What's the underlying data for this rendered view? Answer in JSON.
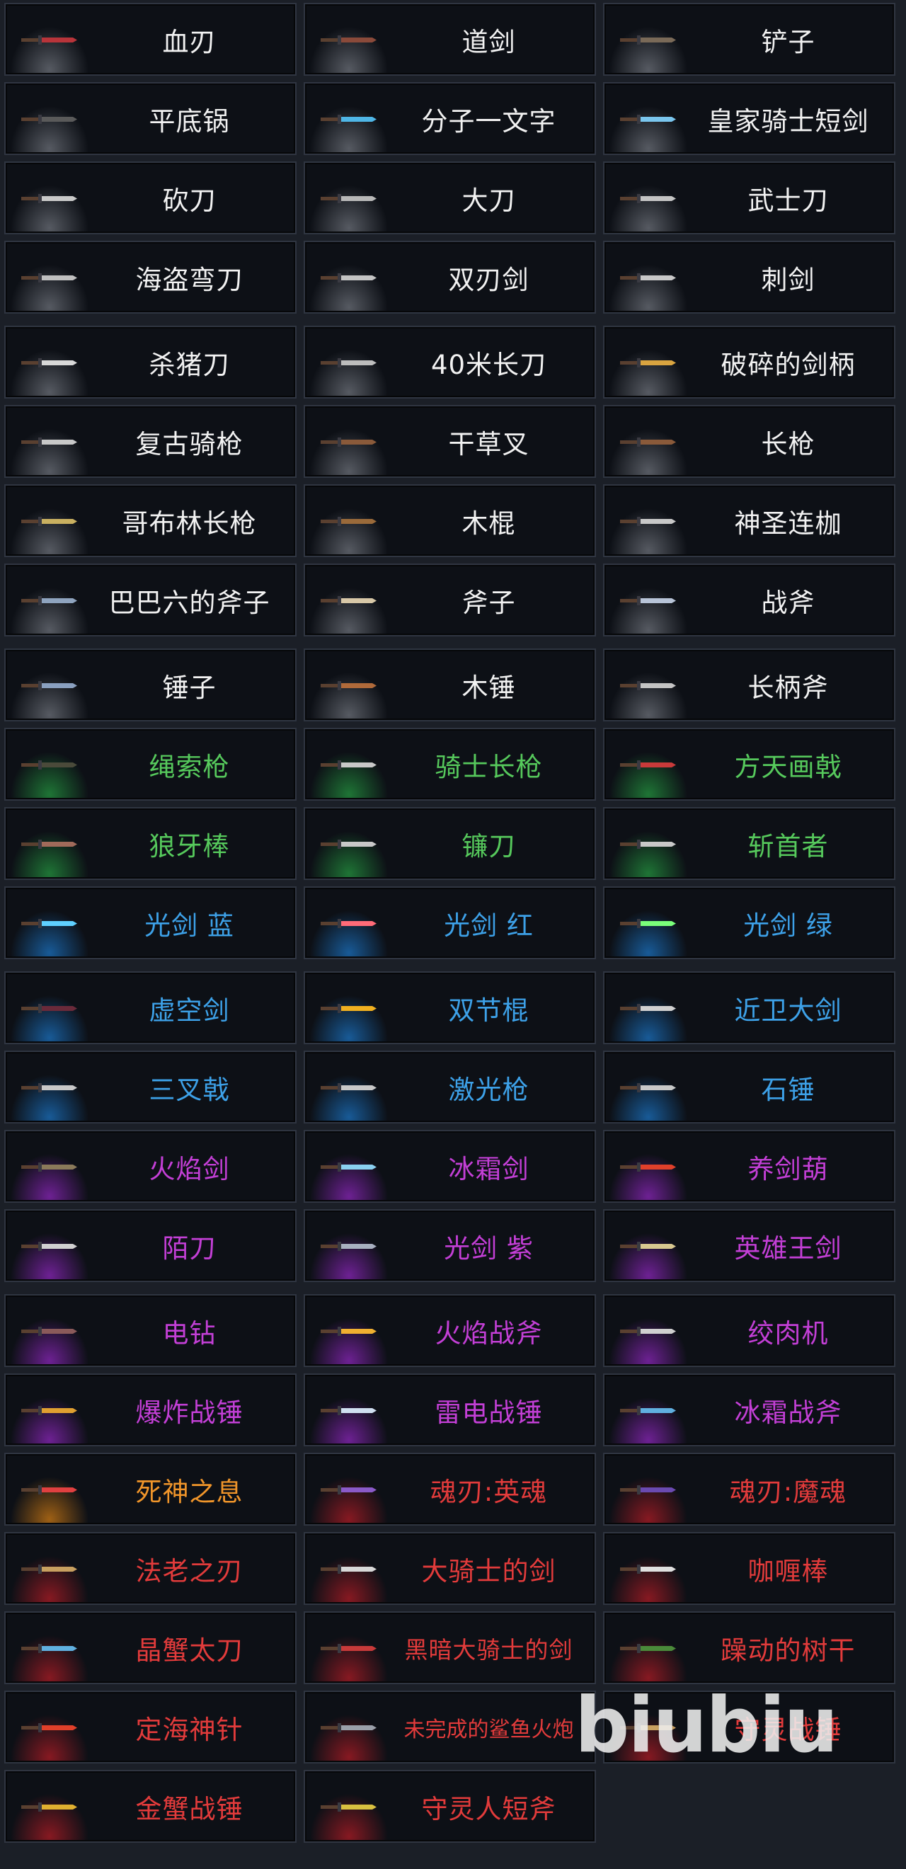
{
  "rarity_colors": {
    "white": "#f2f2f2",
    "green": "#56c95c",
    "blue": "#3da1e8",
    "purple": "#c33fd6",
    "orange": "#f0952a",
    "red": "#e23b3b"
  },
  "weapons": [
    {
      "name": "血刃",
      "rarity": "white",
      "icon": "blood-blade-icon",
      "color": "#b8343a"
    },
    {
      "name": "道剑",
      "rarity": "white",
      "icon": "taoist-sword-icon",
      "color": "#8a4a3a"
    },
    {
      "name": "铲子",
      "rarity": "white",
      "icon": "shovel-icon",
      "color": "#7a6a58"
    },
    {
      "name": "平底锅",
      "rarity": "white",
      "icon": "frying-pan-icon",
      "color": "#5a5a5a"
    },
    {
      "name": "分子一文字",
      "rarity": "white",
      "icon": "molecular-katana-icon",
      "color": "#4fb6e6"
    },
    {
      "name": "皇家骑士短剑",
      "rarity": "white",
      "icon": "royal-knight-shortsword-icon",
      "color": "#7ac6ee"
    },
    {
      "name": "砍刀",
      "rarity": "white",
      "icon": "machete-icon",
      "color": "#c9c9c9"
    },
    {
      "name": "大刀",
      "rarity": "white",
      "icon": "broadsword-icon",
      "color": "#b8b8b8"
    },
    {
      "name": "武士刀",
      "rarity": "white",
      "icon": "katana-icon",
      "color": "#c4c4c4"
    },
    {
      "name": "海盗弯刀",
      "rarity": "white",
      "icon": "pirate-cutlass-icon",
      "color": "#c0c0c0"
    },
    {
      "name": "双刃剑",
      "rarity": "white",
      "icon": "double-edged-sword-icon",
      "color": "#c4c4c4"
    },
    {
      "name": "刺剑",
      "rarity": "white",
      "icon": "rapier-icon",
      "color": "#c8c8c8"
    },
    {
      "name": "杀猪刀",
      "rarity": "white",
      "icon": "butcher-knife-icon",
      "color": "#d8d8d8"
    },
    {
      "name": "40米长刀",
      "rarity": "white",
      "icon": "long-blade-icon",
      "color": "#bdbdbd"
    },
    {
      "name": "破碎的剑柄",
      "rarity": "white",
      "icon": "broken-hilt-icon",
      "color": "#d9a440"
    },
    {
      "name": "复古骑枪",
      "rarity": "white",
      "icon": "retro-lance-icon",
      "color": "#c8c8c8"
    },
    {
      "name": "干草叉",
      "rarity": "white",
      "icon": "pitchfork-icon",
      "color": "#8a5a3a"
    },
    {
      "name": "长枪",
      "rarity": "white",
      "icon": "spear-icon",
      "color": "#8a5a3a"
    },
    {
      "name": "哥布林长枪",
      "rarity": "white",
      "icon": "goblin-spear-icon",
      "color": "#c9b060"
    },
    {
      "name": "木棍",
      "rarity": "white",
      "icon": "wooden-staff-icon",
      "color": "#9a6a3a"
    },
    {
      "name": "神圣连枷",
      "rarity": "white",
      "icon": "holy-flail-icon",
      "color": "#c8c8c8"
    },
    {
      "name": "巴巴六的斧子",
      "rarity": "white",
      "icon": "babaliu-axe-icon",
      "color": "#8fa4bf"
    },
    {
      "name": "斧子",
      "rarity": "white",
      "icon": "axe-icon",
      "color": "#d8c8a8"
    },
    {
      "name": "战斧",
      "rarity": "white",
      "icon": "battle-axe-icon",
      "color": "#b8c4d8"
    },
    {
      "name": "锤子",
      "rarity": "white",
      "icon": "hammer-icon",
      "color": "#8aa0c0"
    },
    {
      "name": "木锤",
      "rarity": "white",
      "icon": "wooden-mallet-icon",
      "color": "#b06a3a"
    },
    {
      "name": "长柄斧",
      "rarity": "white",
      "icon": "halberd-icon",
      "color": "#c4c4c4"
    },
    {
      "name": "绳索枪",
      "rarity": "green",
      "icon": "rope-gun-icon",
      "color": "#4a4a3a"
    },
    {
      "name": "骑士长枪",
      "rarity": "green",
      "icon": "knight-lance-icon",
      "color": "#c8c8c8"
    },
    {
      "name": "方天画戟",
      "rarity": "green",
      "icon": "sky-piercer-halberd-icon",
      "color": "#c83a3a"
    },
    {
      "name": "狼牙棒",
      "rarity": "green",
      "icon": "spiked-club-icon",
      "color": "#a06a5a"
    },
    {
      "name": "镰刀",
      "rarity": "green",
      "icon": "scythe-icon",
      "color": "#c8c8c8"
    },
    {
      "name": "斩首者",
      "rarity": "green",
      "icon": "executioner-icon",
      "color": "#c8c8c8"
    },
    {
      "name": "光剑  蓝",
      "rarity": "blue",
      "icon": "lightsaber-blue-icon",
      "color": "#5fd0ff"
    },
    {
      "name": "光剑  红",
      "rarity": "blue",
      "icon": "lightsaber-red-icon",
      "color": "#ff6b78"
    },
    {
      "name": "光剑  绿",
      "rarity": "blue",
      "icon": "lightsaber-green-icon",
      "color": "#7aff7a"
    },
    {
      "name": "虚空剑",
      "rarity": "blue",
      "icon": "void-sword-icon",
      "color": "#6a2a3a"
    },
    {
      "name": "双节棍",
      "rarity": "blue",
      "icon": "nunchaku-icon",
      "color": "#f0b020"
    },
    {
      "name": "近卫大剑",
      "rarity": "blue",
      "icon": "guard-greatsword-icon",
      "color": "#d0d0d0"
    },
    {
      "name": "三叉戟",
      "rarity": "blue",
      "icon": "trident-icon",
      "color": "#c8c8c8"
    },
    {
      "name": "激光枪",
      "rarity": "blue",
      "icon": "laser-spear-icon",
      "color": "#c8c8c8"
    },
    {
      "name": "石锤",
      "rarity": "blue",
      "icon": "stone-hammer-icon",
      "color": "#c8c8c8"
    },
    {
      "name": "火焰剑",
      "rarity": "purple",
      "icon": "flame-sword-icon",
      "color": "#8a7a5a"
    },
    {
      "name": "冰霜剑",
      "rarity": "purple",
      "icon": "frost-sword-icon",
      "color": "#8ad0f0"
    },
    {
      "name": "养剑葫",
      "rarity": "purple",
      "icon": "sword-gourd-icon",
      "color": "#e0402a"
    },
    {
      "name": "陌刀",
      "rarity": "purple",
      "icon": "mo-blade-icon",
      "color": "#d0d0d0"
    },
    {
      "name": "光剑  紫",
      "rarity": "purple",
      "icon": "lightsaber-purple-icon",
      "color": "#a8b0c0"
    },
    {
      "name": "英雄王剑",
      "rarity": "purple",
      "icon": "hero-king-sword-icon",
      "color": "#d8c890"
    },
    {
      "name": "电钻",
      "rarity": "purple",
      "icon": "drill-icon",
      "color": "#8a5a5a"
    },
    {
      "name": "火焰战斧",
      "rarity": "purple",
      "icon": "flame-war-axe-icon",
      "color": "#f0b030"
    },
    {
      "name": "绞肉机",
      "rarity": "purple",
      "icon": "meat-grinder-icon",
      "color": "#d0d0d0"
    },
    {
      "name": "爆炸战锤",
      "rarity": "purple",
      "icon": "explosive-warhammer-icon",
      "color": "#e0a030"
    },
    {
      "name": "雷电战锤",
      "rarity": "purple",
      "icon": "thunder-warhammer-icon",
      "color": "#d0e0f0"
    },
    {
      "name": "冰霜战斧",
      "rarity": "purple",
      "icon": "frost-war-axe-icon",
      "color": "#60b0e0"
    },
    {
      "name": "死神之息",
      "rarity": "orange",
      "icon": "death-breath-icon",
      "color": "#e04040"
    },
    {
      "name": "魂刃:英魂",
      "rarity": "red",
      "icon": "soul-blade-hero-icon",
      "color": "#8a5ac8"
    },
    {
      "name": "魂刃:魔魂",
      "rarity": "red",
      "icon": "soul-blade-demon-icon",
      "color": "#6a4ab0"
    },
    {
      "name": "法老之刃",
      "rarity": "red",
      "icon": "pharaoh-blade-icon",
      "color": "#c8a060"
    },
    {
      "name": "大骑士的剑",
      "rarity": "red",
      "icon": "grand-knight-sword-icon",
      "color": "#d8d8d8"
    },
    {
      "name": "咖喱棒",
      "rarity": "red",
      "icon": "excalibur-icon",
      "color": "#e0e0e0"
    },
    {
      "name": "晶蟹太刀",
      "rarity": "red",
      "icon": "crystal-crab-tachi-icon",
      "color": "#60b0e0"
    },
    {
      "name": "黑暗大骑士的剑",
      "rarity": "red",
      "icon": "dark-grand-knight-sword-icon",
      "color": "#c83a3a"
    },
    {
      "name": "躁动的树干",
      "rarity": "red",
      "icon": "restless-trunk-icon",
      "color": "#4a8a3a"
    },
    {
      "name": "定海神针",
      "rarity": "red",
      "icon": "sea-pillar-staff-icon",
      "color": "#e0402a"
    },
    {
      "name": "未完成的鲨鱼火炮",
      "rarity": "red",
      "icon": "unfinished-shark-cannon-icon",
      "color": "#9aa0aa"
    },
    {
      "name": "守灵战锤",
      "rarity": "red",
      "icon": "wake-warhammer-icon",
      "color": "#c8a060"
    },
    {
      "name": "金蟹战锤",
      "rarity": "red",
      "icon": "golden-crab-warhammer-icon",
      "color": "#e0b030"
    },
    {
      "name": "守灵人短斧",
      "rarity": "red",
      "icon": "wake-keeper-hatchet-icon",
      "color": "#d8c040"
    }
  ],
  "watermark": "biubiu"
}
